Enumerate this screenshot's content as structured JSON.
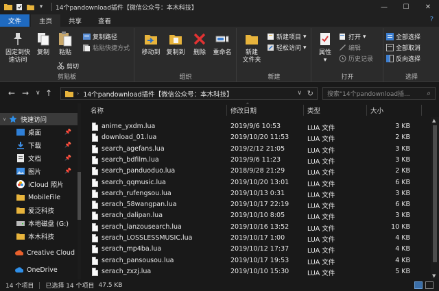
{
  "window": {
    "title": "14个pandownload插件【微信公众号：本木科技】"
  },
  "ribbon_tabs": [
    {
      "label": "文件"
    },
    {
      "label": "主页"
    },
    {
      "label": "共享"
    },
    {
      "label": "查看"
    }
  ],
  "ribbon": {
    "clipboard": {
      "pin": "固定到快",
      "pin2": "速访问",
      "copy": "复制",
      "paste": "粘贴",
      "copy_path": "复制路径",
      "paste_shortcut": "粘贴快捷方式",
      "cut": "剪切",
      "label": "剪贴板"
    },
    "organize": {
      "move_to": "移动到",
      "copy_to": "复制到",
      "delete": "删除",
      "rename": "重命名",
      "label": "组织"
    },
    "new": {
      "new_folder": "新建",
      "new_folder2": "文件夹",
      "new_item": "新建项目",
      "easy_access": "轻松访问",
      "label": "新建"
    },
    "open": {
      "properties": "属性",
      "open": "打开",
      "edit": "编辑",
      "history": "历史记录",
      "label": "打开"
    },
    "select": {
      "select_all": "全部选择",
      "select_none": "全部取消",
      "invert": "反向选择",
      "label": "选择"
    }
  },
  "address": {
    "path": "14个pandownload插件【微信公众号：本木科技】",
    "search_placeholder": "搜索\"14个pandownload插..."
  },
  "sidebar": {
    "items": [
      {
        "label": "快速访问",
        "icon": "star-icon"
      },
      {
        "label": "桌面",
        "icon": "desktop-icon"
      },
      {
        "label": "下载",
        "icon": "download-icon"
      },
      {
        "label": "文档",
        "icon": "document-icon"
      },
      {
        "label": "图片",
        "icon": "picture-icon"
      },
      {
        "label": "iCloud 照片",
        "icon": "icloud-icon"
      },
      {
        "label": "MobileFile",
        "icon": "folder-icon"
      },
      {
        "label": "爱泛科技",
        "icon": "folder-icon"
      },
      {
        "label": "本地磁盘 (G:)",
        "icon": "drive-icon"
      },
      {
        "label": "本木科技",
        "icon": "folder-icon"
      },
      {
        "label": "Creative Cloud",
        "icon": "creative-cloud-icon"
      },
      {
        "label": "OneDrive",
        "icon": "onedrive-icon"
      }
    ]
  },
  "columns": {
    "name": "名称",
    "date": "修改日期",
    "type": "类型",
    "size": "大小"
  },
  "files": [
    {
      "name": "anime_yxdm.lua",
      "date": "2019/9/6 10:53",
      "type": "LUA 文件",
      "size": "3 KB"
    },
    {
      "name": "download_01.lua",
      "date": "2019/10/20 11:53",
      "type": "LUA 文件",
      "size": "2 KB"
    },
    {
      "name": "search_agefans.lua",
      "date": "2019/2/12 21:05",
      "type": "LUA 文件",
      "size": "3 KB"
    },
    {
      "name": "search_bdfilm.lua",
      "date": "2019/9/6 11:23",
      "type": "LUA 文件",
      "size": "3 KB"
    },
    {
      "name": "search_panduoduo.lua",
      "date": "2018/9/28 21:29",
      "type": "LUA 文件",
      "size": "2 KB"
    },
    {
      "name": "search_qqmusic.lua",
      "date": "2019/10/20 13:01",
      "type": "LUA 文件",
      "size": "6 KB"
    },
    {
      "name": "search_rufengsou.lua",
      "date": "2019/10/13 0:31",
      "type": "LUA 文件",
      "size": "3 KB"
    },
    {
      "name": "serach_58wangpan.lua",
      "date": "2019/10/17 22:19",
      "type": "LUA 文件",
      "size": "6 KB"
    },
    {
      "name": "serach_dalipan.lua",
      "date": "2019/10/10 8:05",
      "type": "LUA 文件",
      "size": "3 KB"
    },
    {
      "name": "serach_lanzousearch.lua",
      "date": "2019/10/16 13:52",
      "type": "LUA 文件",
      "size": "10 KB"
    },
    {
      "name": "serach_LOSSLESSMUSIC.lua",
      "date": "2019/10/17 1:00",
      "type": "LUA 文件",
      "size": "4 KB"
    },
    {
      "name": "serach_mp4ba.lua",
      "date": "2019/10/12 17:37",
      "type": "LUA 文件",
      "size": "4 KB"
    },
    {
      "name": "serach_pansousou.lua",
      "date": "2019/10/17 19:53",
      "type": "LUA 文件",
      "size": "4 KB"
    },
    {
      "name": "serach_zxzj.lua",
      "date": "2019/10/10 15:30",
      "type": "LUA 文件",
      "size": "5 KB"
    }
  ],
  "status": {
    "count": "14 个项目",
    "selected": "已选择 14 个项目",
    "size": "47.5 KB"
  }
}
